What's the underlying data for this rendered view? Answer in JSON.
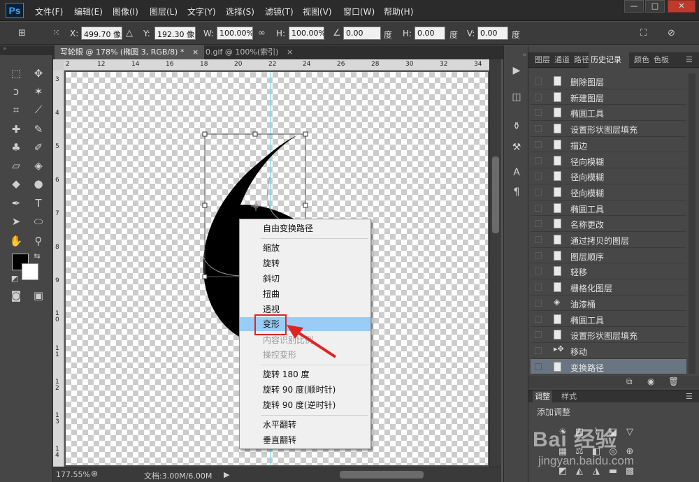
{
  "app": {
    "logo": "Ps",
    "menu": [
      "文件(F)",
      "编辑(E)",
      "图像(I)",
      "图层(L)",
      "文字(Y)",
      "选择(S)",
      "滤镜(T)",
      "视图(V)",
      "窗口(W)",
      "帮助(H)"
    ],
    "window_buttons": [
      "—",
      "□",
      "✕"
    ]
  },
  "options": {
    "x_label": "X:",
    "x_value": "499.70 像素",
    "y_label": "Y:",
    "y_value": "192.30 像素",
    "w_label": "W:",
    "w_value": "100.00%",
    "h_label": "H:",
    "h_value": "100.00%",
    "angle_value": "0.00",
    "angle_unit": "度",
    "hskew_label": "H:",
    "hskew_value": "0.00",
    "hskew_unit": "度",
    "vskew_label": "V:",
    "vskew_value": "0.00",
    "vskew_unit": "度"
  },
  "tabs": [
    {
      "label": "写轮眼 @ 178% (椭圆 3, RGB/8) *",
      "close": "×"
    },
    {
      "label": "0.gif @ 100%(索引)",
      "close": "×"
    }
  ],
  "rulers": {
    "top": [
      "2",
      "12",
      "14",
      "16",
      "18",
      "20",
      "22",
      "24",
      "26",
      "28",
      "30",
      "32",
      "34"
    ],
    "left": [
      "3",
      "4",
      "5",
      "6",
      "7",
      "8",
      "9",
      "1 0",
      "1 1",
      "1 2",
      "1 3",
      "1 4"
    ]
  },
  "context_menu": {
    "items": [
      {
        "label": "自由变换路径",
        "enabled": true
      },
      {
        "label": "缩放",
        "enabled": true
      },
      {
        "label": "旋转",
        "enabled": true
      },
      {
        "label": "斜切",
        "enabled": true
      },
      {
        "label": "扭曲",
        "enabled": true
      },
      {
        "label": "透视",
        "enabled": true
      },
      {
        "label": "变形",
        "enabled": true,
        "highlighted": true
      },
      {
        "label": "内容识别比例",
        "enabled": false
      },
      {
        "label": "操控变形",
        "enabled": false
      },
      {
        "label": "旋转 180 度",
        "enabled": true
      },
      {
        "label": "旋转 90 度(顺时针)",
        "enabled": true
      },
      {
        "label": "旋转 90 度(逆时针)",
        "enabled": true
      },
      {
        "label": "水平翻转",
        "enabled": true
      },
      {
        "label": "垂直翻转",
        "enabled": true
      }
    ]
  },
  "status": {
    "zoom": "177.55%",
    "doc": "文档:3.00M/6.00M"
  },
  "panel": {
    "tabs": [
      "图层",
      "通道",
      "路径",
      "历史记录",
      "颜色",
      "色板"
    ],
    "history": [
      "删除图层",
      "新建图层",
      "椭圆工具",
      "设置形状图层填充",
      "描边",
      "径向模糊",
      "径向模糊",
      "径向模糊",
      "椭圆工具",
      "名称更改",
      "通过拷贝的图层",
      "图层顺序",
      "轻移",
      "栅格化图层",
      "油漆桶",
      "椭圆工具",
      "设置形状图层填充",
      "移动",
      "变换路径"
    ],
    "adjust_tabs": [
      "调整",
      "样式"
    ],
    "adjust_title": "添加调整"
  },
  "watermark": {
    "logo": "Bai 经验",
    "url": "jingyan.baidu.com"
  },
  "colors": {
    "highlight": "#99ccf6",
    "annotation_red": "#e02424",
    "guide": "#5fd3e6",
    "history_active": "#6a7584"
  }
}
